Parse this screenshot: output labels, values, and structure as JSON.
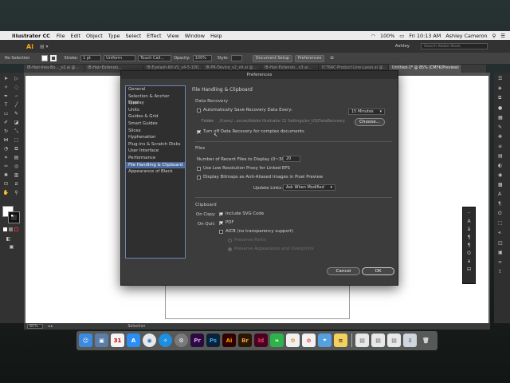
{
  "menubar": {
    "app_name": "Illustrator CC",
    "items": [
      "File",
      "Edit",
      "Object",
      "Type",
      "Select",
      "Effect",
      "View",
      "Window",
      "Help"
    ],
    "battery": "100%",
    "clock": "Fri 10:13 AM",
    "user": "Ashley Cameron"
  },
  "titlebar": {
    "logo": "Ai",
    "workspace": "Ashley",
    "search_placeholder": "Search Adobe Stock"
  },
  "control_bar": {
    "selection_label": "No Selection",
    "stroke_label": "Stroke:",
    "stroke_value": "1 pt",
    "profile": "Uniform",
    "brush": "Touch Call...",
    "opacity_label": "Opacity:",
    "opacity_value": "100%",
    "style_label": "Style:",
    "doc_setup": "Document Setup",
    "preferences": "Preferences"
  },
  "tabs": [
    {
      "label": "IB-Hair-Ines-Bo..._v2.ai @..."
    },
    {
      "label": "IB-Hair-Extensio..."
    },
    {
      "label": "IB-Eyelash-Kit-V2_x4-5-100..."
    },
    {
      "label": "IB-PR-Device_v2_x4.ai @..."
    },
    {
      "label": "IB-Hair-Extensio...v3.ai..."
    },
    {
      "label": "IC76AC-Product-Line-Lasso.ai @..."
    },
    {
      "label": "Untitled-1* @ 85% (CMYK/Preview)",
      "active": true
    }
  ],
  "status": {
    "zoom": "85%",
    "mode": "Selection"
  },
  "dialog": {
    "title": "Preferences",
    "categories": [
      "General",
      "Selection & Anchor Display",
      "Type",
      "Units",
      "Guides & Grid",
      "Smart Guides",
      "Slices",
      "Hyphenation",
      "Plug-ins & Scratch Disks",
      "User Interface",
      "Performance",
      "File Handling & Clipboard",
      "Appearance of Black"
    ],
    "selected_category": "File Handling & Clipboard",
    "pane_title": "File Handling & Clipboard",
    "data_recovery": {
      "section": "Data Recovery",
      "autosave_label": "Automatically Save Recovery Data Every:",
      "autosave_checked": false,
      "interval": "15 Minutes",
      "folder_label": "Folder:",
      "folder_path": "/Users/...ances/Adobe Illustrator 22 Settings/en_US/DataRecovery",
      "choose_button": "Choose...",
      "turn_off_label": "Turn off Data Recovery for complex documents",
      "turn_off_checked": true
    },
    "files": {
      "section": "Files",
      "recent_label": "Number of Recent Files to Display (0~30):",
      "recent_value": "20",
      "low_res_label": "Use Low Resolution Proxy for Linked EPS",
      "low_res_checked": false,
      "antialias_label": "Display Bitmaps as Anti-Aliased Images in Pixel Preview",
      "antialias_checked": false,
      "update_links_label": "Update Links:",
      "update_links_value": "Ask When Modified"
    },
    "clipboard": {
      "section": "Clipboard",
      "on_copy_label": "On Copy:",
      "include_svg_label": "Include SVG Code",
      "include_svg_checked": true,
      "on_quit_label": "On Quit:",
      "pdf_label": "PDF",
      "pdf_checked": true,
      "aicb_label": "AICB (no transparency support)",
      "aicb_checked": false,
      "preserve_paths_label": "Preserve Paths",
      "preserve_appearance_label": "Preserve Appearance and Overprints"
    },
    "cancel_button": "Cancel",
    "ok_button": "OK"
  },
  "dock_apps": [
    "Finder",
    "Preview",
    "Calendar",
    "App Store",
    "Chrome",
    "Safari",
    "System Preferences",
    "Premiere",
    "Photoshop",
    "Illustrator",
    "Bridge",
    "InDesign",
    "Evernote",
    "Photos",
    "News",
    "Maps",
    "Notes",
    "Files",
    "Trash"
  ]
}
